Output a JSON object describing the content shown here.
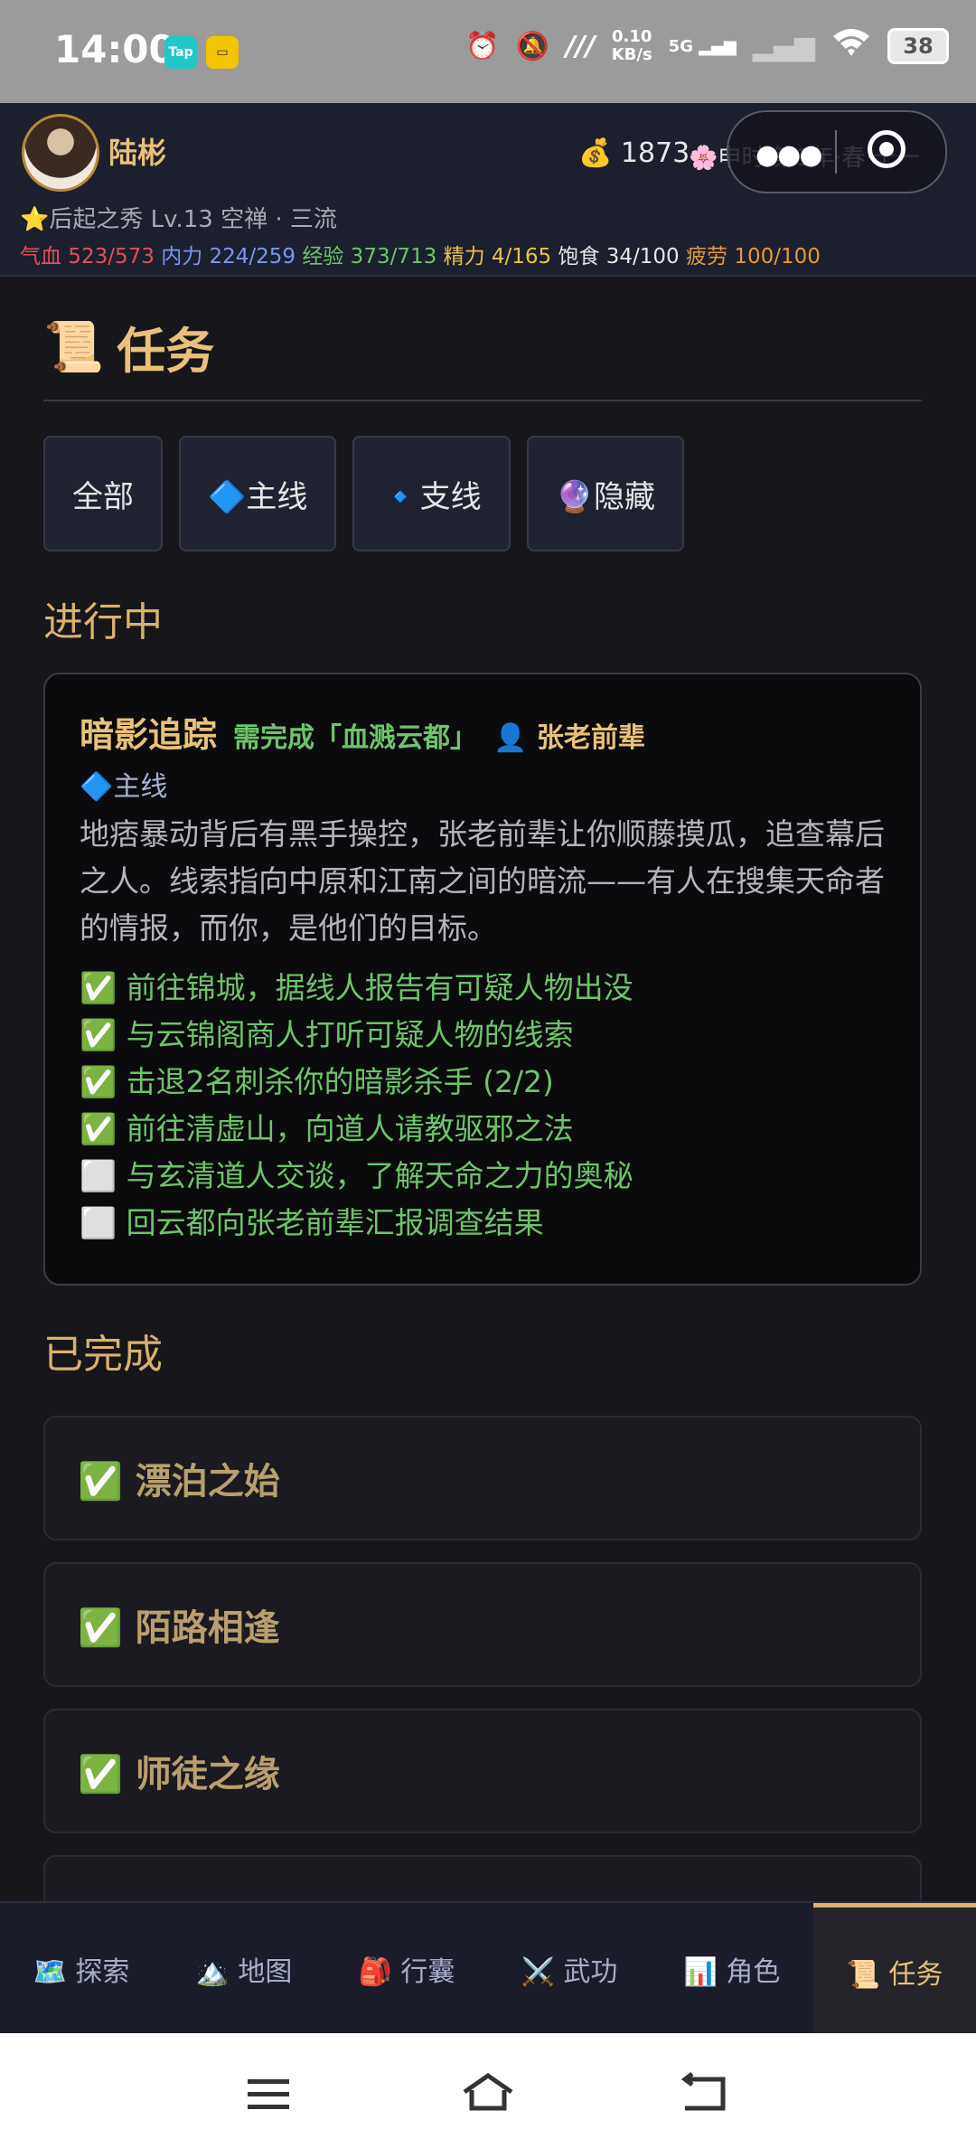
{
  "status_bar": {
    "time": "14:00",
    "app_icons": [
      "TapTap",
      "game"
    ],
    "net_speed_top": "0.10",
    "net_speed_bottom": "KB/s",
    "network": "5G",
    "battery": "38"
  },
  "header": {
    "player_name": "陆彬",
    "money": "💰 1873",
    "time_text": "🌸申时·第1年·春·十一",
    "title_line": "⭐后起之秀 Lv.13 空禅 · 三流",
    "stats": {
      "hp": "气血 523/573",
      "mp": "内力 224/259",
      "exp": "经验 373/713",
      "energy": "精力 4/165",
      "food": "饱食 34/100",
      "fatigue": "疲劳 100/100"
    }
  },
  "page": {
    "icon": "📜",
    "title": "任务"
  },
  "filters": [
    {
      "label": "全部"
    },
    {
      "label": "🔷主线"
    },
    {
      "label": "🔹支线"
    },
    {
      "label": "🔮隐藏"
    }
  ],
  "sections": {
    "in_progress": "进行中",
    "completed": "已完成"
  },
  "active_quest": {
    "name": "暗影追踪",
    "requirement": "需完成「血溅云都」",
    "npc": "👤 张老前辈",
    "type": "🔷主线",
    "description": "地痞暴动背后有黑手操控，张老前辈让你顺藤摸瓜，追查幕后之人。线索指向中原和江南之间的暗流——有人在搜集天命者的情报，而你，是他们的目标。",
    "steps": [
      "✅ 前往锦城，据线人报告有可疑人物出没",
      "✅ 与云锦阁商人打听可疑人物的线索",
      "✅ 击退2名刺杀你的暗影杀手 (2/2)",
      "✅ 前往清虚山，向道人请教驱邪之法",
      "⬜ 与玄清道人交谈，了解天命之力的奥秘",
      "⬜ 回云都向张老前辈汇报调查结果"
    ]
  },
  "completed_quests": [
    {
      "label": "✅ 漂泊之始"
    },
    {
      "label": "✅ 陌路相逢"
    },
    {
      "label": "✅ 师徒之缘"
    }
  ],
  "bottom_nav": [
    {
      "label": "🗺️ 探索"
    },
    {
      "label": "🏔️ 地图"
    },
    {
      "label": "🎒 行囊"
    },
    {
      "label": "⚔️ 武功"
    },
    {
      "label": "📊 角色"
    },
    {
      "label": "📜 任务",
      "active": true
    }
  ],
  "colors": {
    "accent_gold": "#e8c27a",
    "step_green": "#6ec46a",
    "background": "#16161b"
  }
}
